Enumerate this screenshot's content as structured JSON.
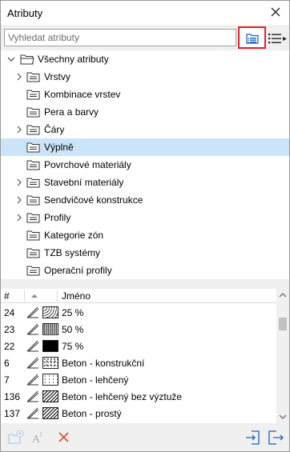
{
  "window": {
    "title": "Atributy"
  },
  "search": {
    "placeholder": "Vyhledat atributy",
    "value": ""
  },
  "tree": {
    "root": "Všechny atributy",
    "items": [
      {
        "label": "Vrstvy",
        "expandable": true,
        "selected": false
      },
      {
        "label": "Kombinace vrstev",
        "expandable": false,
        "selected": false
      },
      {
        "label": "Pera a barvy",
        "expandable": false,
        "selected": false
      },
      {
        "label": "Čáry",
        "expandable": true,
        "selected": false
      },
      {
        "label": "Výplně",
        "expandable": false,
        "selected": true
      },
      {
        "label": "Povrchové materiály",
        "expandable": false,
        "selected": false
      },
      {
        "label": "Stavební materiály",
        "expandable": true,
        "selected": false
      },
      {
        "label": "Sendvičové konstrukce",
        "expandable": true,
        "selected": false
      },
      {
        "label": "Profily",
        "expandable": true,
        "selected": false
      },
      {
        "label": "Kategorie zón",
        "expandable": false,
        "selected": false
      },
      {
        "label": "TZB systémy",
        "expandable": false,
        "selected": false
      },
      {
        "label": "Operační profily",
        "expandable": false,
        "selected": false
      }
    ]
  },
  "table": {
    "columns": {
      "num": "#",
      "name": "Jméno"
    },
    "rows": [
      {
        "num": "24",
        "name": "25 %",
        "pattern": "dots-light"
      },
      {
        "num": "23",
        "name": "50 %",
        "pattern": "dots-medium"
      },
      {
        "num": "22",
        "name": "75 %",
        "pattern": "dots-dense"
      },
      {
        "num": "6",
        "name": "Beton - konstrukční",
        "pattern": "concrete"
      },
      {
        "num": "7",
        "name": "Beton - lehčený",
        "pattern": "concrete-light"
      },
      {
        "num": "136",
        "name": "Beton - lehčený bez výztuže",
        "pattern": "hatch"
      },
      {
        "num": "137",
        "name": "Beton - prostý",
        "pattern": "hatch"
      }
    ]
  },
  "colors": {
    "selection": "#cce4f7",
    "highlight": "#e5202a",
    "icon_blue": "#1e63b4",
    "delete_red": "#e0572b"
  },
  "icons": [
    "close-icon",
    "tree-view-icon",
    "menu-icon",
    "folder-icon",
    "chevron-right-icon",
    "chevron-down-icon",
    "pen-icon",
    "new-attribute-icon",
    "rename-icon",
    "delete-icon",
    "import-icon",
    "export-icon"
  ]
}
